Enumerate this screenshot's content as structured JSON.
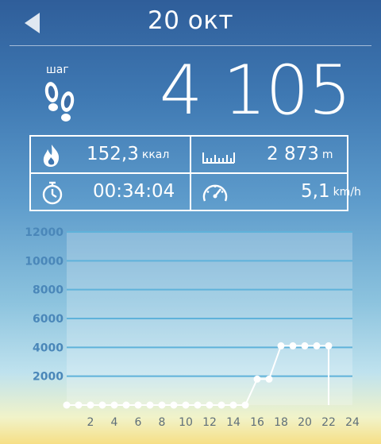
{
  "header": {
    "title": "20 окт"
  },
  "steps": {
    "label": "шаг",
    "value": "4 105"
  },
  "stats": {
    "calories": {
      "value": "152,3",
      "unit": "ккал"
    },
    "distance": {
      "value": "2 873",
      "unit": "m"
    },
    "duration": {
      "value": "00:34:04"
    },
    "speed": {
      "value": "5,1",
      "unit": "km/h"
    }
  },
  "icons": [
    "back-arrow-icon",
    "footprints-icon",
    "flame-icon",
    "ruler-icon",
    "stopwatch-icon",
    "speedometer-icon"
  ],
  "chart_data": {
    "type": "line",
    "x": [
      0,
      1,
      2,
      3,
      4,
      5,
      6,
      7,
      8,
      9,
      10,
      11,
      12,
      13,
      14,
      15,
      16,
      17,
      18,
      19,
      20,
      21,
      22
    ],
    "values": [
      0,
      0,
      0,
      0,
      0,
      0,
      0,
      0,
      0,
      0,
      0,
      0,
      0,
      0,
      0,
      0,
      1800,
      1800,
      4105,
      4105,
      4105,
      4105,
      4105
    ],
    "yticks": [
      "2000",
      "4000",
      "6000",
      "8000",
      "10000",
      "12000"
    ],
    "xticks": [
      "2",
      "4",
      "6",
      "8",
      "10",
      "12",
      "14",
      "16",
      "18",
      "20",
      "22",
      "24"
    ],
    "ylim": [
      0,
      12000
    ],
    "xlim": [
      0,
      24
    ],
    "grid": true
  }
}
